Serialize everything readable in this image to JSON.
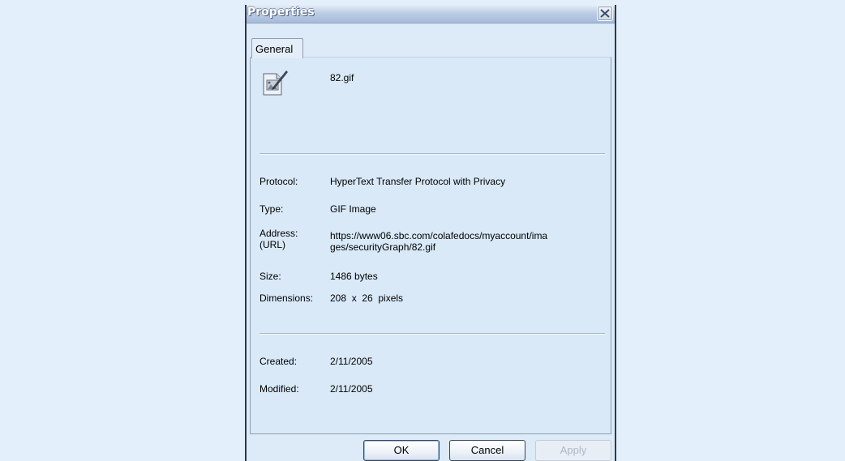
{
  "window": {
    "title": "Properties",
    "close_icon": "close-icon"
  },
  "tabs": [
    {
      "label": "General",
      "selected": true
    }
  ],
  "file": {
    "icon": "gif-image-file-icon",
    "name": "82.gif"
  },
  "details": {
    "protocol_label": "Protocol:",
    "protocol_value": "HyperText Transfer Protocol with Privacy",
    "type_label": "Type:",
    "type_value": "GIF Image",
    "address_label_line1": "Address:",
    "address_label_line2": "(URL)",
    "address_value_line1": "https://www06.sbc.com/colafedocs/myaccount/ima",
    "address_value_line2": "ges/securityGraph/82.gif",
    "size_label": "Size:",
    "size_value": "1486 bytes",
    "dimensions_label": "Dimensions:",
    "dimensions_value": "208  x  26  pixels"
  },
  "dates": {
    "created_label": "Created:",
    "created_value": "2/11/2005",
    "modified_label": "Modified:",
    "modified_value": "2/11/2005"
  },
  "buttons": {
    "ok": "OK",
    "cancel": "Cancel",
    "apply": "Apply",
    "apply_enabled": false
  },
  "colors": {
    "backdrop": "#e3f0fb",
    "dialog_background": "#ddeaf7",
    "titlebar": "#bccde4"
  }
}
